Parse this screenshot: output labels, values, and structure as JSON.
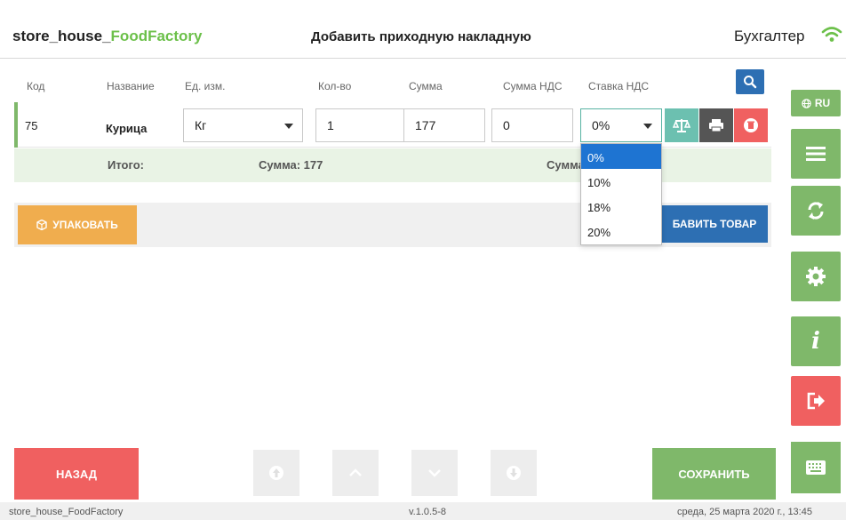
{
  "header": {
    "brand_prefix": "store_house_",
    "brand_accent": "FoodFactory",
    "title": "Добавить приходную накладную",
    "user": "Бухгалтер",
    "wifi_icon": "wifi-icon"
  },
  "sidebar": {
    "lang_label": "RU",
    "lang_icon": "globe-icon",
    "items": [
      "menu-icon",
      "sync-icon",
      "settings-icon",
      "info-icon",
      "logout-icon"
    ]
  },
  "table": {
    "columns": [
      "Код",
      "Название",
      "Ед. изм.",
      "Кол-во",
      "Сумма",
      "Сумма НДС",
      "Ставка НДС"
    ],
    "row": {
      "code": "75",
      "name": "Курица",
      "unit": "Кг",
      "qty": "1",
      "sum": "177",
      "vat_sum": "0",
      "vat_rate": "0%"
    }
  },
  "totals": {
    "label": "Итого:",
    "sum_text": "Сумма: 177",
    "vat_sum_partial": "Сумма"
  },
  "dropdown": {
    "options": [
      "0%",
      "10%",
      "18%",
      "20%"
    ],
    "selected": "0%"
  },
  "actions": {
    "pack_label": "УПАКОВАТЬ",
    "add_label": "БАВИТЬ ТОВАР",
    "back_label": "НАЗАД",
    "save_label": "СОХРАНИТЬ"
  },
  "footer": {
    "left": "store_house_FoodFactory",
    "version": "v.1.0.5-8",
    "datetime": "среда, 25 марта 2020 г., 13:45"
  },
  "colors": {
    "green": "#7fb86a",
    "red": "#f06060",
    "blue": "#2d6fb3",
    "orange": "#f0ad4e",
    "teal": "#6cc0b0",
    "dark": "#555555"
  }
}
